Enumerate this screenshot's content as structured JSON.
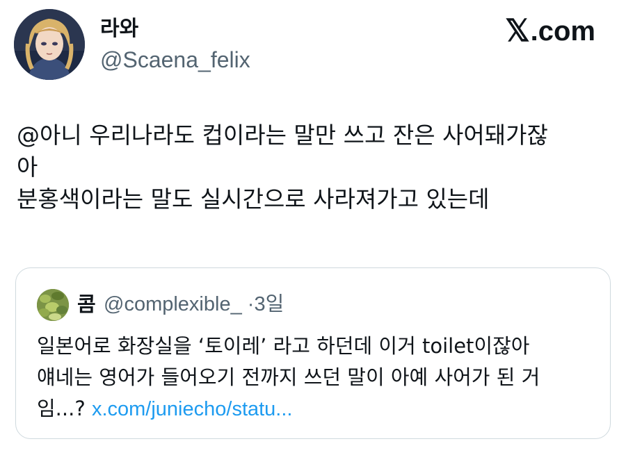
{
  "author": {
    "display_name": "라와",
    "handle": "@Scaena_felix",
    "avatar_icon": "anime-character-avatar"
  },
  "brand": {
    "mark": "𝕏",
    "text": ".com"
  },
  "tweet": {
    "lines": [
      "@아니 우리나라도 컵이라는 말만 쓰고 잔은 사어돼가잖",
      "아",
      "분홍색이라는 말도 실시간으로 사라져가고 있는데"
    ]
  },
  "quoted": {
    "display_name": "콤",
    "handle": "@complexible_",
    "separator": "·",
    "time": "3일",
    "avatar_icon": "green-food-avatar",
    "lines": [
      "일본어로 화장실을 ‘토이레’ 라고 하던데 이거 toilet이잖아",
      "얘네는 영어가 들어오기 전까지 쓰던 말이 아예 사어가 된 거"
    ],
    "last_line_text": "임...? ",
    "link": "x.com/juniecho/statu..."
  },
  "colors": {
    "text": "#0f1419",
    "secondary": "#536471",
    "link": "#1d9bf0",
    "border": "#cfd9de"
  }
}
